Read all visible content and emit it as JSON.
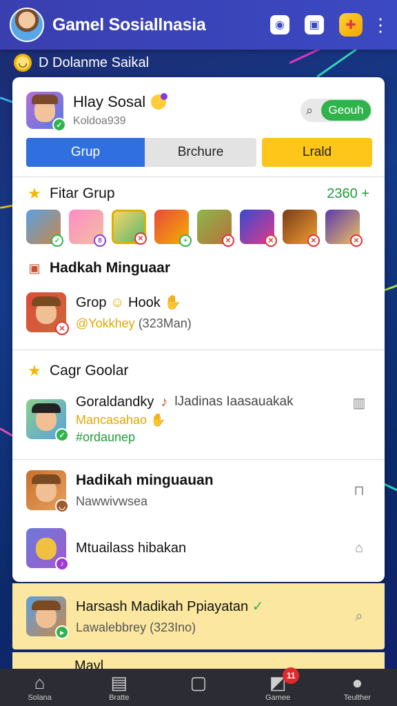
{
  "app": {
    "title": "Gamel Sosiallnasia"
  },
  "topbar": {
    "icons": [
      "camera-icon",
      "shop-icon",
      "game-controller-icon",
      "more-vertical-icon"
    ]
  },
  "subheader": {
    "label": "D Dolanme Saikal"
  },
  "profile": {
    "name": "Hlay Sosal",
    "handle": "Koldoa939",
    "search_button": "Geouh"
  },
  "tabs": [
    {
      "label": "Grup",
      "active": true
    },
    {
      "label": "Brchure",
      "active": false
    },
    {
      "label": "Lrald",
      "active": false
    }
  ],
  "featured": {
    "title": "Fitar Grup",
    "count": "2360 +"
  },
  "section2": {
    "title": "Hadkah Minguaar"
  },
  "group_item": {
    "title": "Grop",
    "title_suffix": "Hook",
    "sub": "@Yokkhey",
    "sub_meta": "(323Man)"
  },
  "section3": {
    "title": "Cagr Goolar"
  },
  "chat_item": {
    "title": "Goraldandky",
    "title_right": "lJadinas Iaasauakak",
    "line2": "Mancasahao",
    "line3": "#ordaunep"
  },
  "list_item_1": {
    "title": "Hadikah minguauan",
    "sub": "Nawwivwsea"
  },
  "list_item_2": {
    "title": "Mtuailass hibakan"
  },
  "highlight_item": {
    "title": "Harsash Madikah Ppiayatan",
    "sub": "Lawalebbrey (323Ino)"
  },
  "peek_item": {
    "title": "Mavl"
  },
  "bottom_nav": [
    {
      "label": "Solana",
      "icon": "home-icon"
    },
    {
      "label": "Bratte",
      "icon": "list-icon"
    },
    {
      "label": "",
      "icon": "square-icon"
    },
    {
      "label": "Gamee",
      "icon": "games-icon",
      "badge": "11"
    },
    {
      "label": "Teulther",
      "icon": "profile-icon"
    }
  ],
  "colors": {
    "topbar": "#3b49c2",
    "tab_active": "#2f6fe0",
    "tab_yellow": "#ffc61a",
    "green": "#2fb34a",
    "highlight": "#fbe7a0"
  }
}
